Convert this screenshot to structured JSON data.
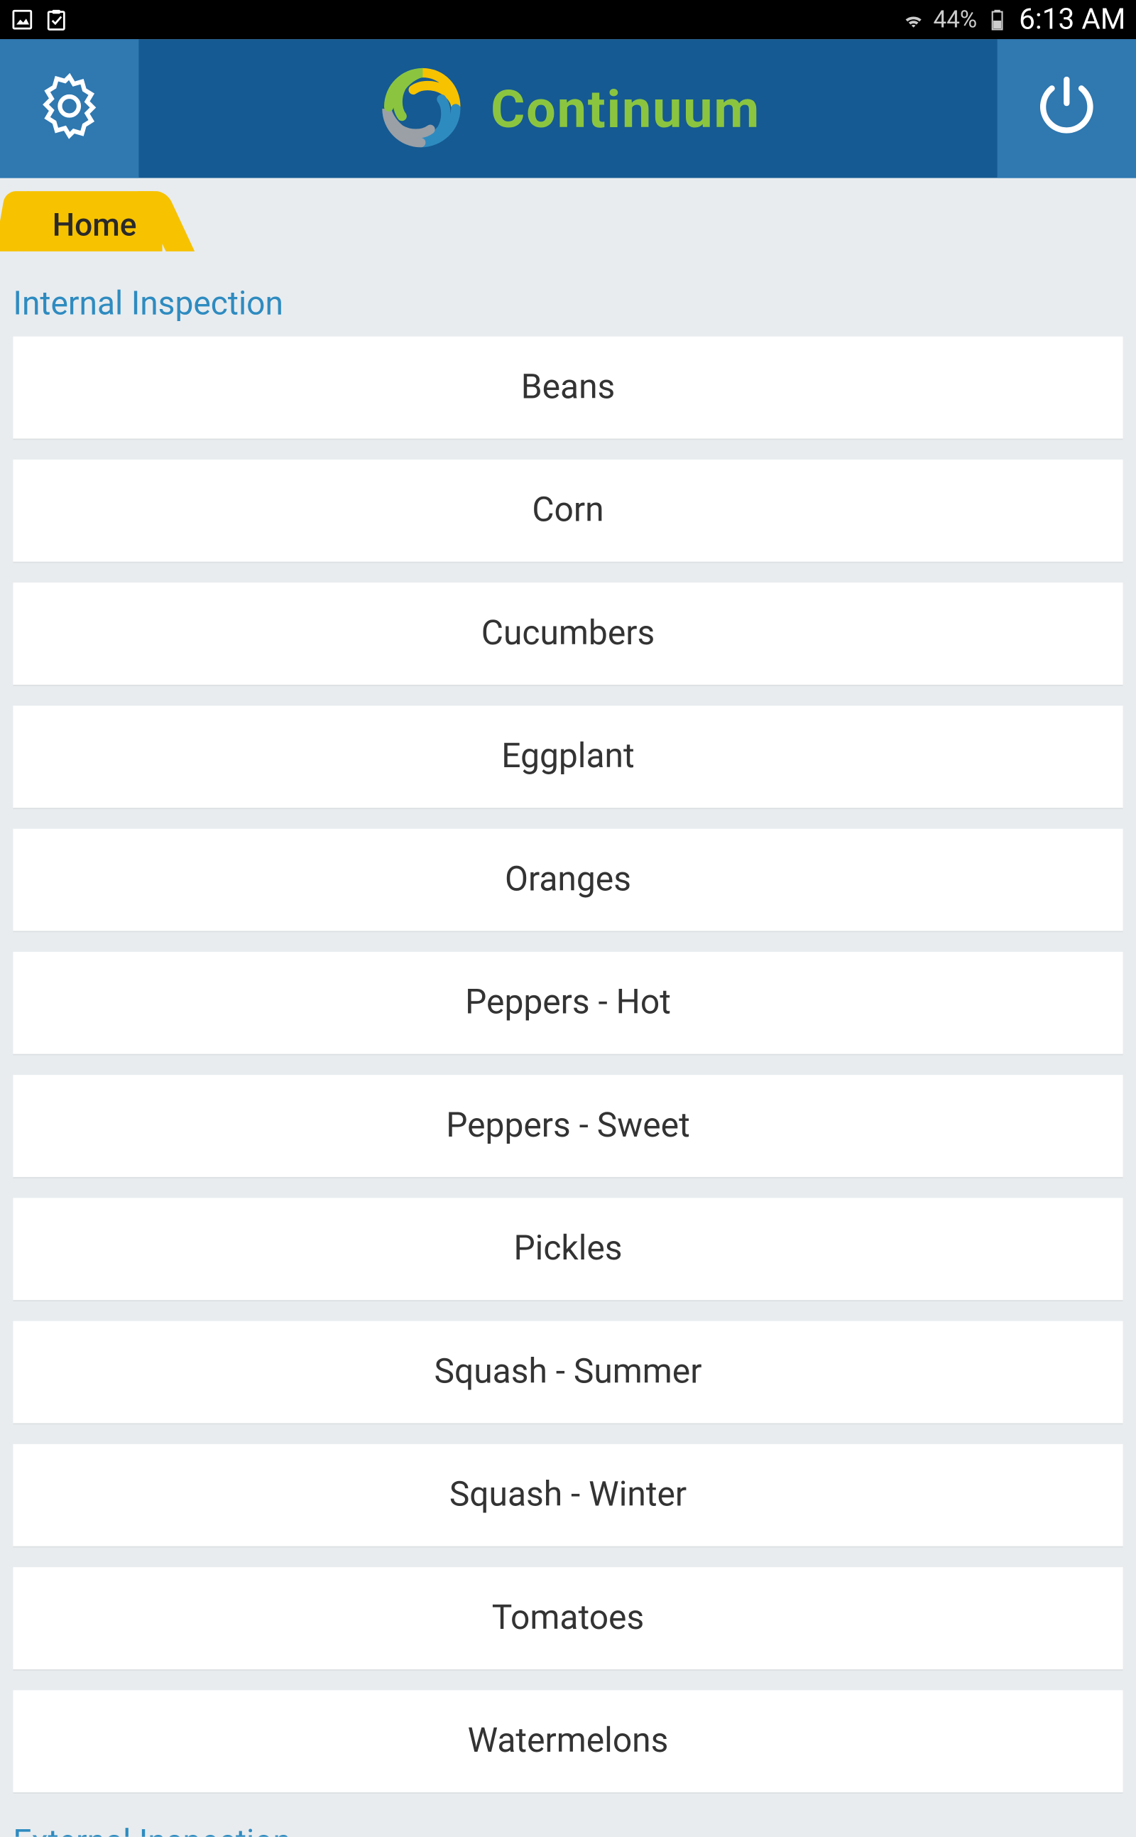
{
  "status": {
    "battery": "44%",
    "time": "6:13 AM"
  },
  "app": {
    "title": "Continuum"
  },
  "tab": {
    "label": "Home"
  },
  "sections": {
    "internal": {
      "title": "Internal Inspection",
      "items": [
        "Beans",
        "Corn",
        "Cucumbers",
        "Eggplant",
        "Oranges",
        "Peppers - Hot",
        "Peppers - Sweet",
        "Pickles",
        "Squash - Summer",
        "Squash - Winter",
        "Tomatoes",
        "Watermelons"
      ]
    },
    "external": {
      "title": "External Inspection"
    }
  }
}
